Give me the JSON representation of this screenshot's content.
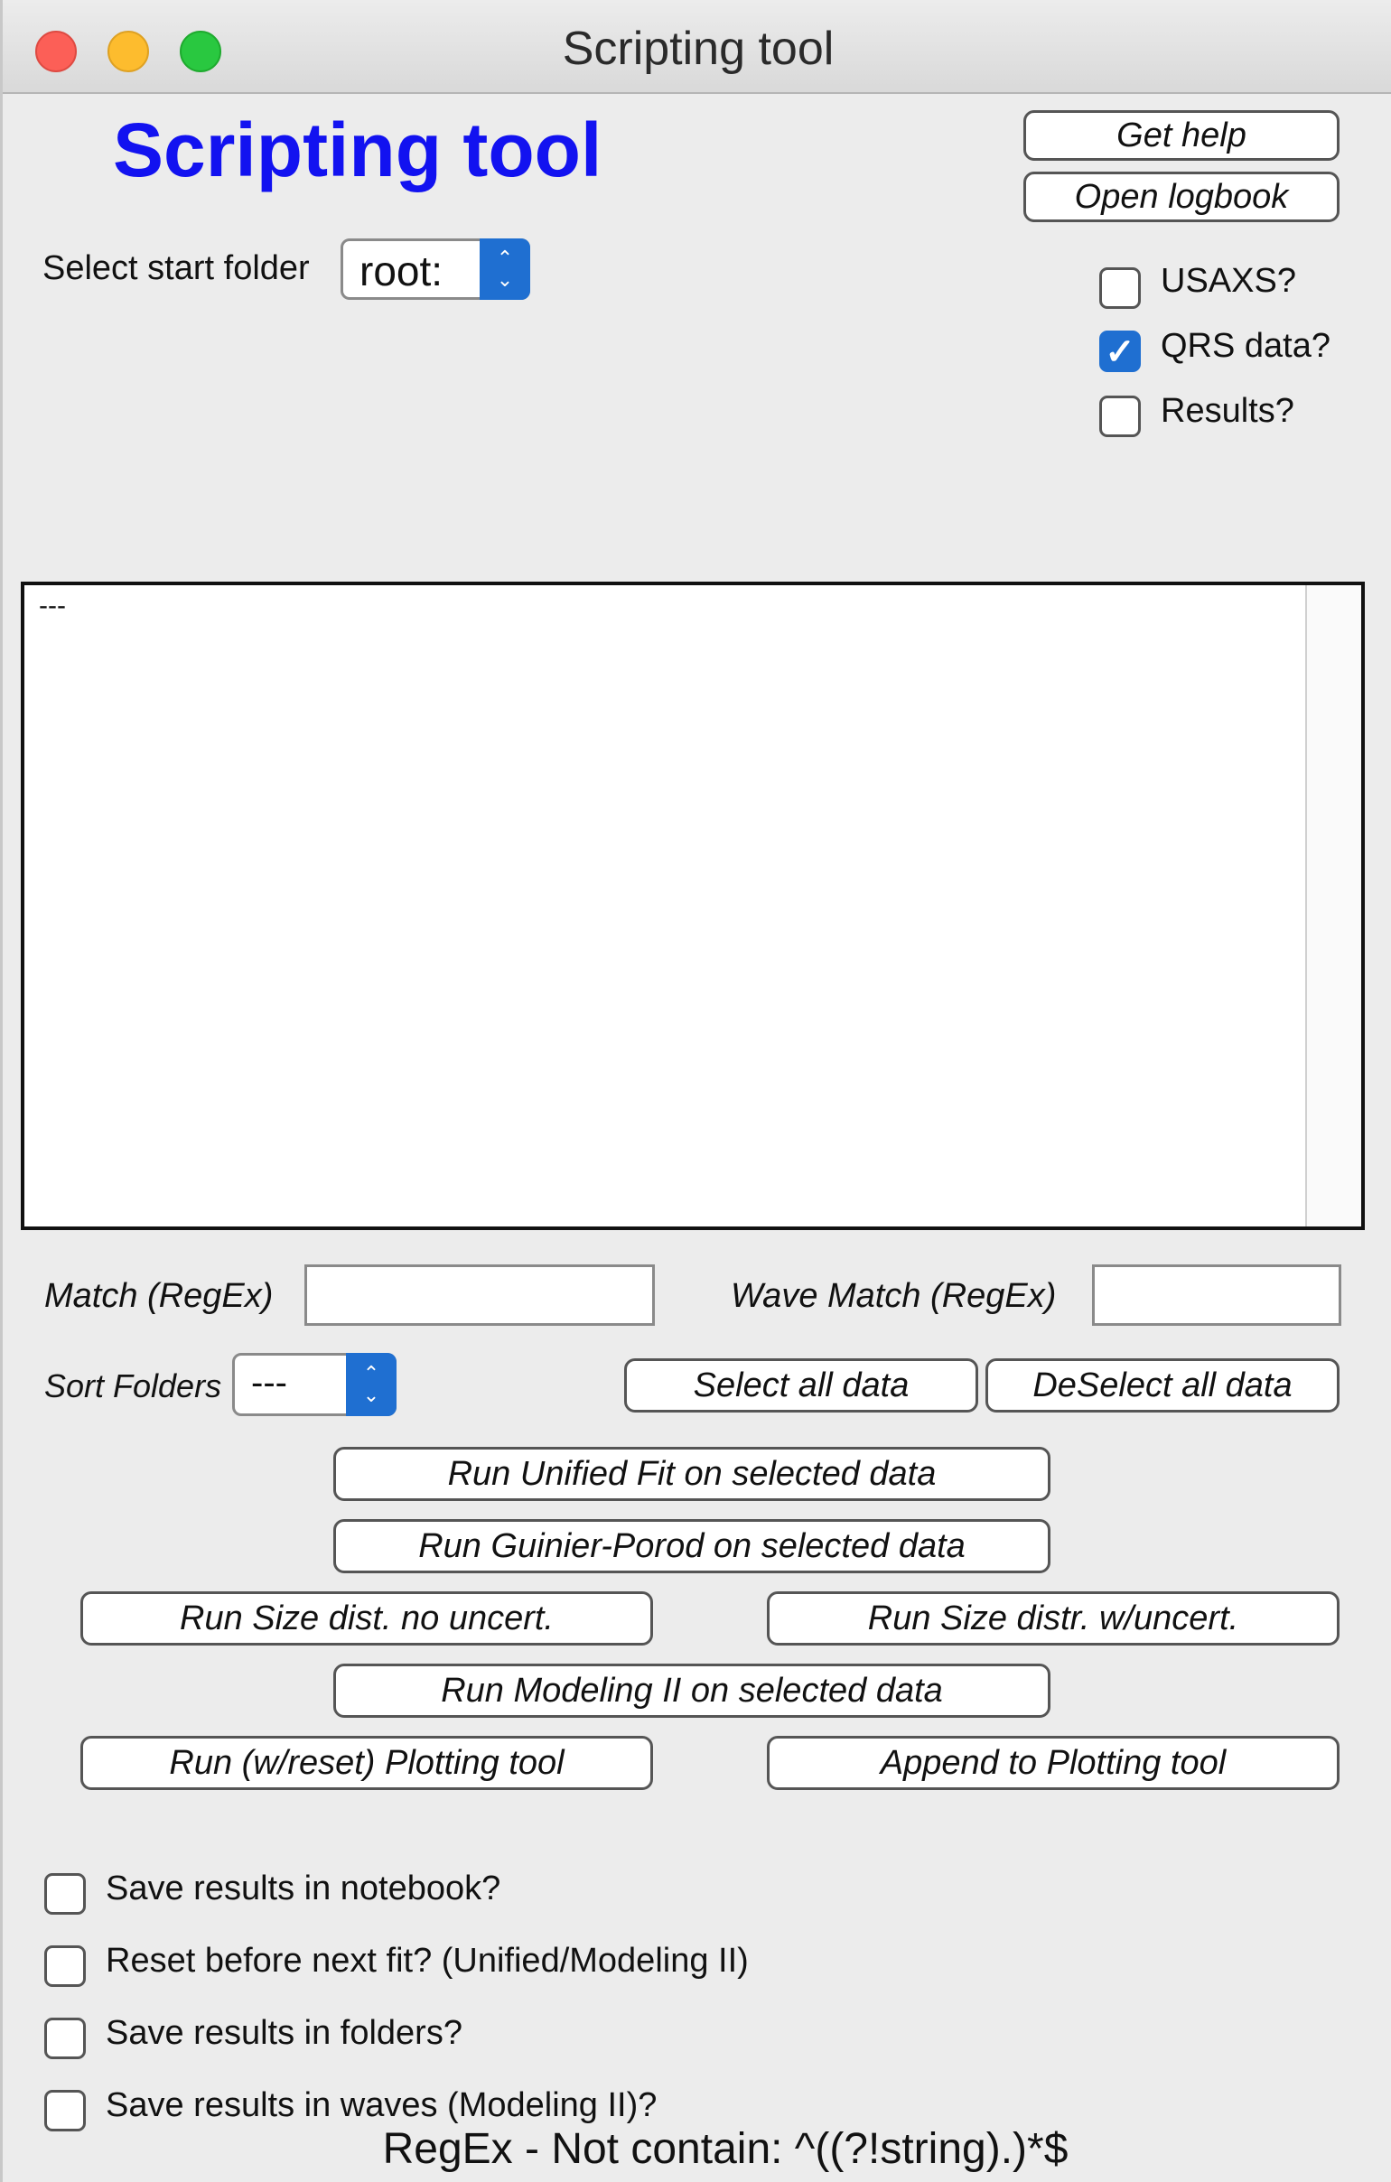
{
  "window": {
    "title": "Scripting tool"
  },
  "header": {
    "title": "Scripting tool"
  },
  "toolbar": {
    "get_help": "Get help",
    "open_logbook": "Open logbook"
  },
  "folder": {
    "label": "Select start folder",
    "value": "root:"
  },
  "options": {
    "usaxs": {
      "label": "USAXS?",
      "checked": false
    },
    "qrs": {
      "label": "QRS data?",
      "checked": true
    },
    "results": {
      "label": "Results?",
      "checked": false
    }
  },
  "list": {
    "items": [
      "---"
    ]
  },
  "filters": {
    "match_label": "Match (RegEx)",
    "match_value": "",
    "wave_match_label": "Wave Match (RegEx)",
    "wave_match_value": ""
  },
  "sort": {
    "label": "Sort Folders",
    "value": "---"
  },
  "buttons": {
    "select_all": "Select all data",
    "deselect_all": "DeSelect all data",
    "unified_fit": "Run Unified Fit on selected data",
    "guinier_porod": "Run Guinier-Porod on selected data",
    "size_no_uncert": "Run Size dist. no uncert.",
    "size_w_uncert": "Run Size distr. w/uncert.",
    "modeling_ii": "Run Modeling II on selected data",
    "plotting_reset": "Run (w/reset) Plotting tool",
    "append_plotting": "Append to Plotting tool"
  },
  "save_options": [
    {
      "label": "Save results in notebook?",
      "checked": false
    },
    {
      "label": "Reset before next fit? (Unified/Modeling II)",
      "checked": false
    },
    {
      "label": "Save results in folders?",
      "checked": false
    },
    {
      "label": "Save results in waves (Modeling II)?",
      "checked": false
    }
  ],
  "footer": {
    "hint": "RegEx - Not contain: ^((?!string).)*$"
  },
  "colors": {
    "title_blue": "#1212f0",
    "accent": "#1f6fd1"
  }
}
